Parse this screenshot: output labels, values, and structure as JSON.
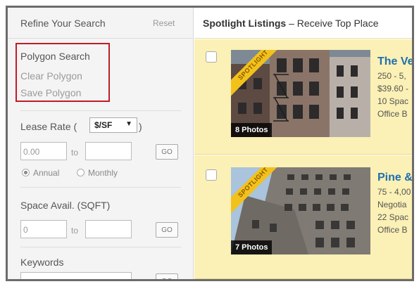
{
  "sidebar": {
    "title": "Refine Your Search",
    "reset": "Reset",
    "polygon": {
      "title": "Polygon Search",
      "clear": "Clear Polygon",
      "save": "Save Polygon"
    },
    "lease_rate": {
      "label": "Lease Rate (",
      "unit": "$/SF",
      "close": ")",
      "min_value": "0.00",
      "to": "to",
      "go": "GO",
      "annual": "Annual",
      "monthly": "Monthly"
    },
    "space": {
      "label": "Space Avail. (SQFT)",
      "min_value": "0",
      "to": "to",
      "go": "GO"
    },
    "keywords": {
      "label": "Keywords",
      "go": "GO"
    }
  },
  "spotlight": {
    "title_bold": "Spotlight Listings",
    "title_rest": " – Receive Top Place"
  },
  "listings": [
    {
      "ribbon": "SPOTLIGHT",
      "photos": "8 Photos",
      "name": "The Ve",
      "lines": [
        "250 - 5,",
        "$39.60 -",
        "10 Spac",
        "Office B"
      ]
    },
    {
      "ribbon": "SPOTLIGHT",
      "photos": "7 Photos",
      "name": "Pine &",
      "lines": [
        "75 - 4,00",
        "Negotia",
        "22 Spac",
        "Office B"
      ]
    }
  ],
  "colors": {
    "poly_border": "#c01c28",
    "listing_bg": "#fbf0b5",
    "link": "#1d6fb0",
    "ribbon": "#f3c11b"
  }
}
